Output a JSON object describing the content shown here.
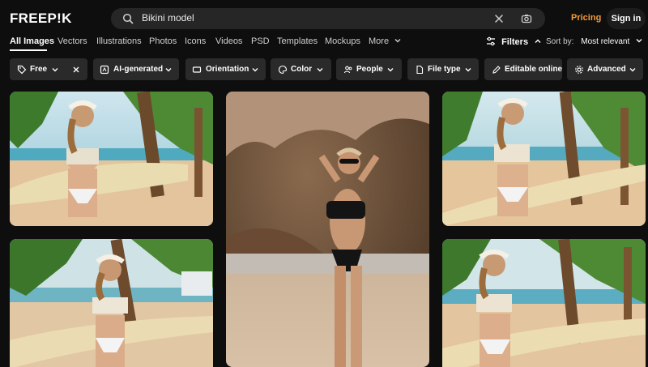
{
  "header": {
    "logo": "FREEP!K",
    "search_value": "Bikini model",
    "pricing": "Pricing",
    "sign_in": "Sign in"
  },
  "tabs": [
    {
      "label": "All Images",
      "active": true
    },
    {
      "label": "Vectors"
    },
    {
      "label": "Illustrations"
    },
    {
      "label": "Photos"
    },
    {
      "label": "Icons"
    },
    {
      "label": "Videos"
    },
    {
      "label": "PSD"
    },
    {
      "label": "Templates"
    },
    {
      "label": "Mockups"
    },
    {
      "label": "More"
    }
  ],
  "toolbar": {
    "filters_label": "Filters",
    "sort_label": "Sort by:",
    "sort_value": "Most relevant"
  },
  "chips": [
    {
      "label": "Free",
      "icon": "tag-icon"
    },
    {
      "label": "AI-generated",
      "icon": "ai-icon"
    },
    {
      "label": "Orientation",
      "icon": "orientation-icon"
    },
    {
      "label": "Color",
      "icon": "palette-icon"
    },
    {
      "label": "People",
      "icon": "people-icon"
    },
    {
      "label": "File type",
      "icon": "file-icon"
    },
    {
      "label": "Editable online",
      "icon": "pen-icon"
    },
    {
      "label": "Advanced",
      "icon": "gear-icon"
    }
  ],
  "colors": {
    "background": "#0e0e0e",
    "chip": "#2a2a2a",
    "pricing": "#f59a3a",
    "search": "#262626"
  },
  "images": [
    {
      "name": "beach-hammock-photo-1"
    },
    {
      "name": "beach-rock-photo"
    },
    {
      "name": "beach-hammock-photo-2"
    },
    {
      "name": "beach-palm-photo-3"
    },
    {
      "name": "beach-palm-photo-4"
    }
  ]
}
